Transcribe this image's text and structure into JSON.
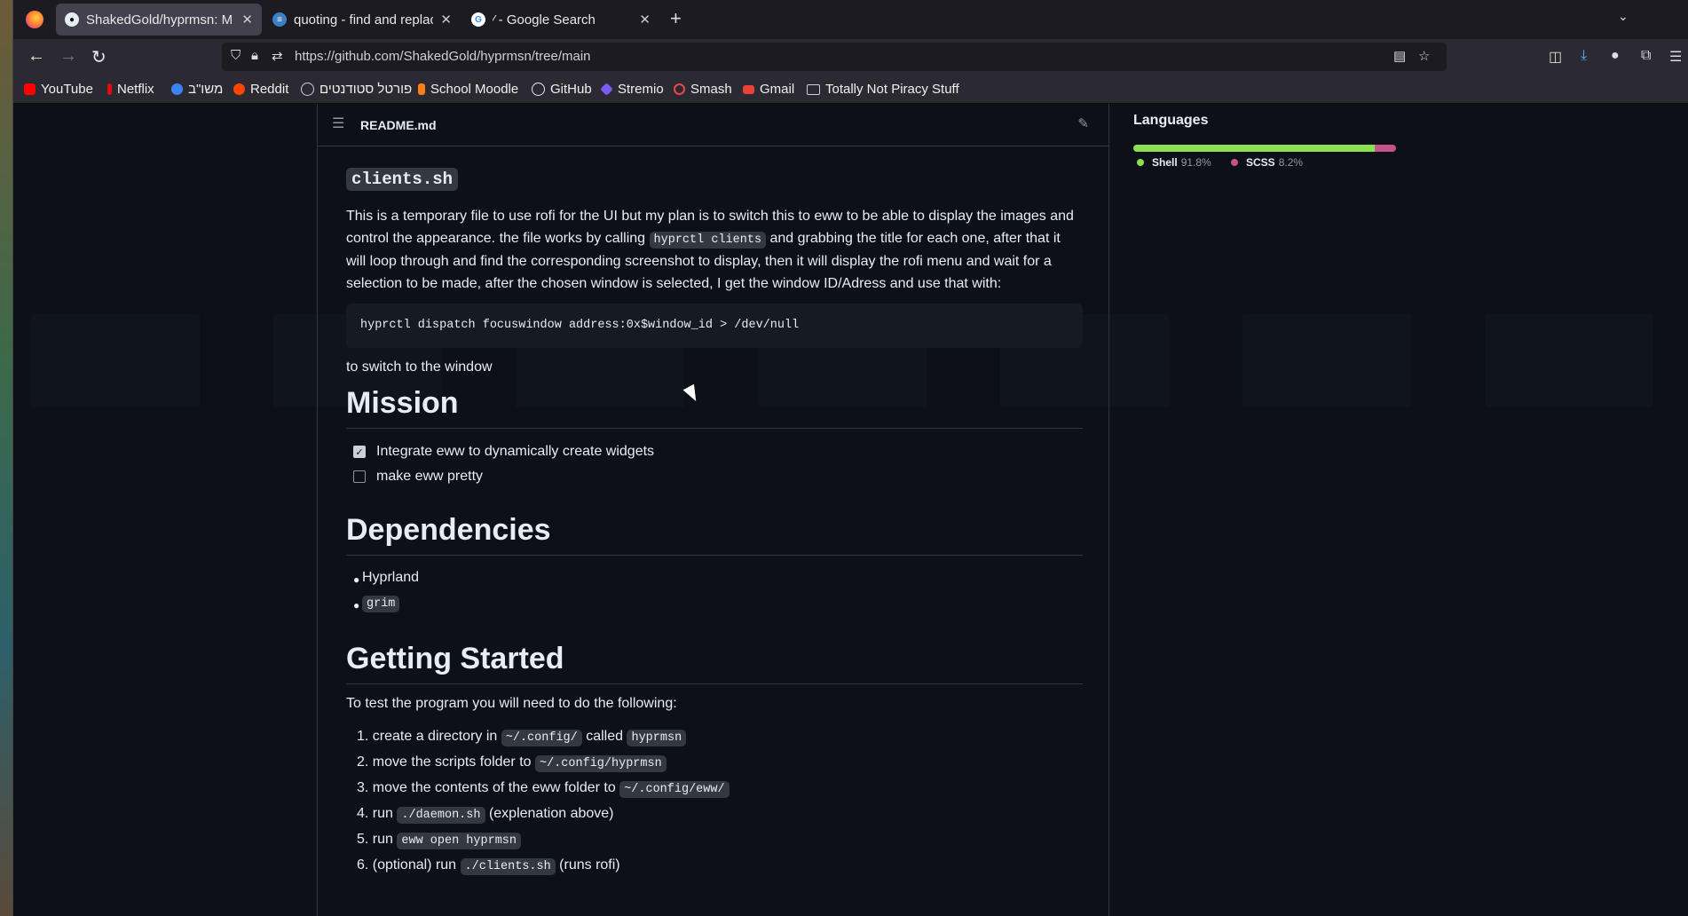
{
  "browser": {
    "tabs": [
      {
        "title": "ShakedGold/hyprmsn: M",
        "active": true,
        "icon": "github-icon"
      },
      {
        "title": "quoting - find and replace",
        "active": false,
        "icon": "stackexchange-icon"
      },
      {
        "title": "⁄ - Google Search",
        "active": false,
        "icon": "google-icon"
      }
    ],
    "url": "https://github.com/ShakedGold/hyprmsn/tree/main"
  },
  "bookmarks": [
    {
      "label": "YouTube",
      "color": "#ff0000"
    },
    {
      "label": "Netflix",
      "color": "#e50914"
    },
    {
      "label": "משו\"ב",
      "color": "#3b82f6"
    },
    {
      "label": "Reddit",
      "color": "#ff4500"
    },
    {
      "label": "פורטל סטודנטים",
      "color": "#8b949e"
    },
    {
      "label": "School Moodle",
      "color": "#f98012"
    },
    {
      "label": "GitHub",
      "color": "#e6edf3"
    },
    {
      "label": "Stremio",
      "color": "#7b5bf5"
    },
    {
      "label": "Smash",
      "color": "#e5484d"
    },
    {
      "label": "Gmail",
      "color": "#ea4335"
    },
    {
      "label": "Totally Not Piracy Stuff",
      "color": "#cfcfd8"
    }
  ],
  "readme": {
    "filename": "README.md",
    "section_code_title": "clients.sh",
    "para1_a": "This is a temporary file to use rofi for the UI but my plan is to switch this to eww to be able to display the images and control the appearance. the file works by calling ",
    "para1_code": "hyprctl clients",
    "para1_b": " and grabbing the title for each one, after that it will loop through and find the corresponding screenshot to display, then it will display the rofi menu and wait for a selection to be made, after the chosen window is selected, I get the window ID/Adress and use that with:",
    "code_block": "hyprctl dispatch focuswindow address:0x$window_id > /dev/null",
    "para2": "to switch to the window",
    "mission_title": "Mission",
    "tasks": [
      {
        "label": "Integrate eww to dynamically create widgets",
        "checked": true
      },
      {
        "label": "make eww pretty",
        "checked": false
      }
    ],
    "deps_title": "Dependencies",
    "deps": [
      "Hyprland",
      "grim"
    ],
    "started_title": "Getting Started",
    "started_intro": "To test the program you will need to do the following:",
    "steps": [
      {
        "num": "1.",
        "parts": [
          "create a directory in ",
          "~/.config/",
          " called ",
          "hyprmsn",
          ""
        ]
      },
      {
        "num": "2.",
        "parts": [
          "move the scripts folder to ",
          "~/.config/hyprmsn",
          ""
        ]
      },
      {
        "num": "3.",
        "parts": [
          "move the contents of the eww folder to ",
          "~/.config/eww/",
          ""
        ]
      },
      {
        "num": "4.",
        "parts": [
          "run ",
          "./daemon.sh",
          " (explenation above)"
        ]
      },
      {
        "num": "5.",
        "parts": [
          "run ",
          "eww open hyprmsn",
          ""
        ]
      },
      {
        "num": "6.",
        "parts": [
          "(optional) run ",
          "./clients.sh",
          " (runs rofi)"
        ]
      }
    ]
  },
  "languages": {
    "title": "Languages",
    "items": [
      {
        "name": "Shell",
        "percent": "91.8%",
        "value": 91.8,
        "color": "#89e051"
      },
      {
        "name": "SCSS",
        "percent": "8.2%",
        "value": 8.2,
        "color": "#c6538c"
      }
    ]
  }
}
